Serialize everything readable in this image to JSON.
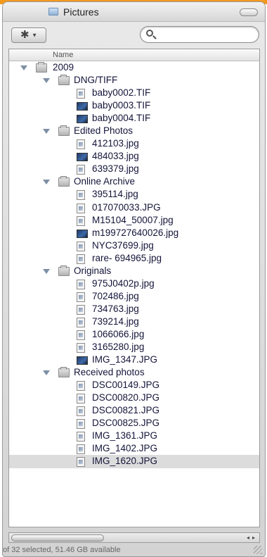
{
  "window": {
    "title": "Pictures"
  },
  "toolbar": {
    "action_icon": "gear-icon",
    "search_placeholder": ""
  },
  "list": {
    "column_header": "Name",
    "rows": [
      {
        "label": "2009",
        "kind": "folder",
        "level": 0,
        "expanded": true
      },
      {
        "label": "DNG/TIFF",
        "kind": "folder",
        "level": 1,
        "expanded": true
      },
      {
        "label": "baby0002.TIF",
        "kind": "file",
        "level": 2
      },
      {
        "label": "baby0003.TIF",
        "kind": "thumb",
        "level": 2
      },
      {
        "label": "baby0004.TIF",
        "kind": "thumb",
        "level": 2
      },
      {
        "label": "Edited Photos",
        "kind": "folder",
        "level": 1,
        "expanded": true
      },
      {
        "label": "412103.jpg",
        "kind": "file",
        "level": 2
      },
      {
        "label": "484033.jpg",
        "kind": "thumb",
        "level": 2
      },
      {
        "label": "639379.jpg",
        "kind": "file",
        "level": 2
      },
      {
        "label": "Online Archive",
        "kind": "folder",
        "level": 1,
        "expanded": true
      },
      {
        "label": "395114.jpg",
        "kind": "file",
        "level": 2
      },
      {
        "label": "017070033.JPG",
        "kind": "file",
        "level": 2
      },
      {
        "label": "M15104_50007.jpg",
        "kind": "file",
        "level": 2
      },
      {
        "label": "m199727640026.jpg",
        "kind": "thumb",
        "level": 2
      },
      {
        "label": "NYC37699.jpg",
        "kind": "file",
        "level": 2
      },
      {
        "label": "rare- 694965.jpg",
        "kind": "file",
        "level": 2
      },
      {
        "label": "Originals",
        "kind": "folder",
        "level": 1,
        "expanded": true
      },
      {
        "label": "975J0402p.jpg",
        "kind": "file",
        "level": 2
      },
      {
        "label": "702486.jpg",
        "kind": "file",
        "level": 2
      },
      {
        "label": "734763.jpg",
        "kind": "file",
        "level": 2
      },
      {
        "label": "739214.jpg",
        "kind": "file",
        "level": 2
      },
      {
        "label": "1066066.jpg",
        "kind": "file",
        "level": 2
      },
      {
        "label": "3165280.jpg",
        "kind": "file",
        "level": 2
      },
      {
        "label": "IMG_1347.JPG",
        "kind": "thumb",
        "level": 2
      },
      {
        "label": "Received photos",
        "kind": "folder",
        "level": 1,
        "expanded": true
      },
      {
        "label": "DSC00149.JPG",
        "kind": "file",
        "level": 2
      },
      {
        "label": "DSC00820.JPG",
        "kind": "file",
        "level": 2
      },
      {
        "label": "DSC00821.JPG",
        "kind": "file",
        "level": 2
      },
      {
        "label": "DSC00825.JPG",
        "kind": "file",
        "level": 2
      },
      {
        "label": "IMG_1361.JPG",
        "kind": "file",
        "level": 2
      },
      {
        "label": "IMG_1402.JPG",
        "kind": "file",
        "level": 2
      },
      {
        "label": "IMG_1620.JPG",
        "kind": "file",
        "level": 2,
        "selected": true
      }
    ]
  },
  "status": {
    "text": "of 32 selected, 51.46 GB available"
  },
  "colors": {
    "accent_strip": "#f39a1e",
    "selection": "#dcdcdc"
  }
}
